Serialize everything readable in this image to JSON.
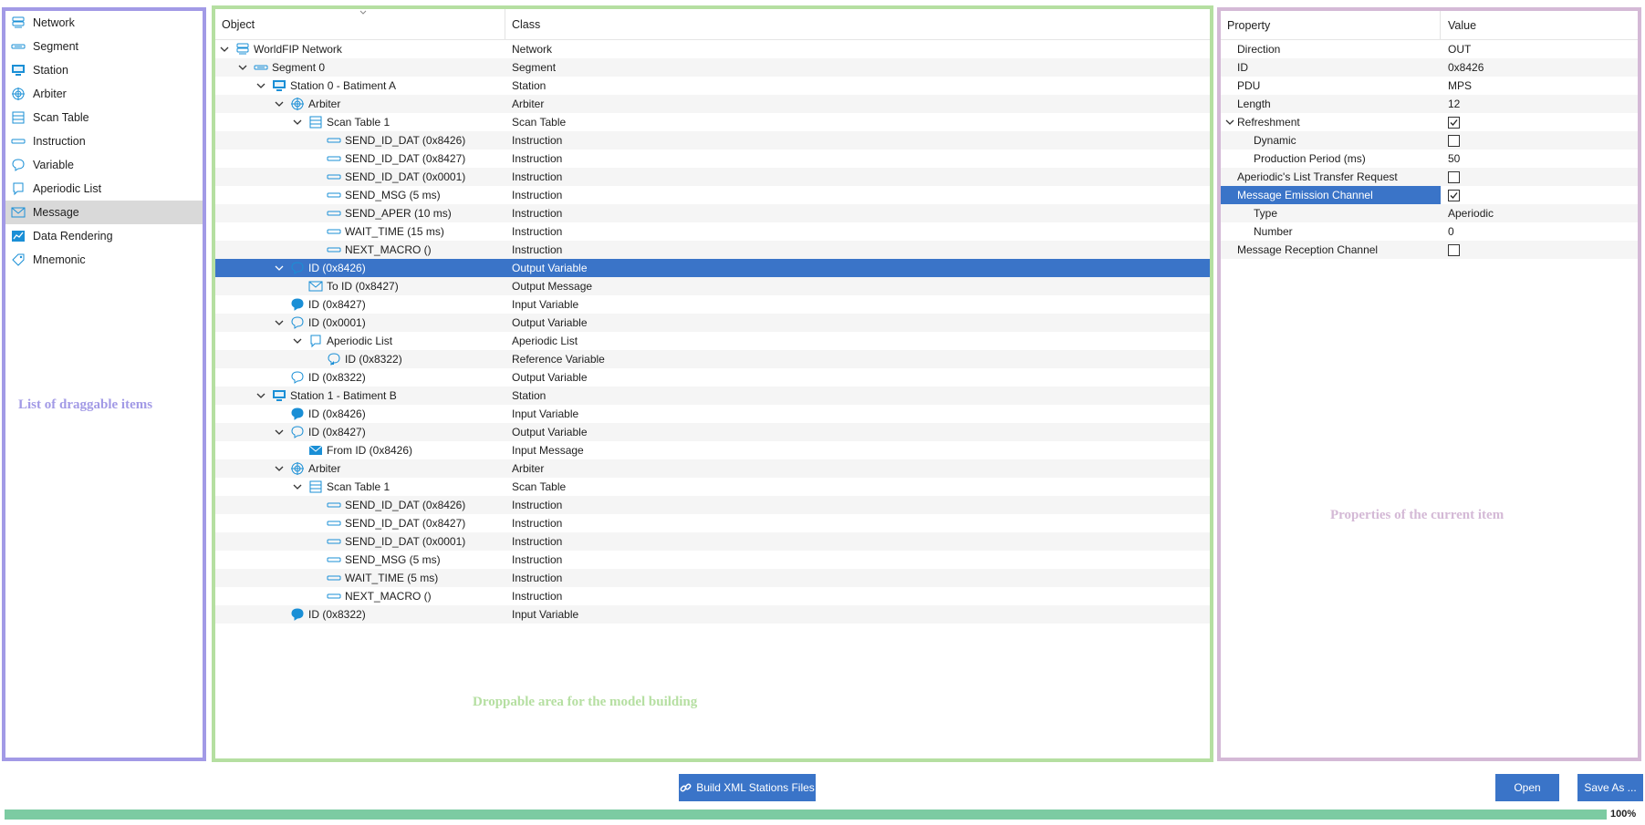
{
  "left_panel": {
    "overlay_label": "List of draggable items",
    "items": [
      {
        "label": "Network",
        "icon": "network-icon",
        "active": false
      },
      {
        "label": "Segment",
        "icon": "segment-icon",
        "active": false
      },
      {
        "label": "Station",
        "icon": "station-icon",
        "active": false
      },
      {
        "label": "Arbiter",
        "icon": "arbiter-icon",
        "active": false
      },
      {
        "label": "Scan Table",
        "icon": "scan-table-icon",
        "active": false
      },
      {
        "label": "Instruction",
        "icon": "instruction-icon",
        "active": false
      },
      {
        "label": "Variable",
        "icon": "variable-icon",
        "active": false
      },
      {
        "label": "Aperiodic List",
        "icon": "aperiodic-list-icon",
        "active": false
      },
      {
        "label": "Message",
        "icon": "message-icon",
        "active": true
      },
      {
        "label": "Data Rendering",
        "icon": "data-rendering-icon",
        "active": false
      },
      {
        "label": "Mnemonic",
        "icon": "mnemonic-icon",
        "active": false
      }
    ]
  },
  "tree": {
    "header": {
      "object": "Object",
      "class": "Class"
    },
    "overlay_label": "Droppable area for the model building",
    "rows": [
      {
        "depth": 0,
        "chevron": "down",
        "icon": "network-icon",
        "name": "WorldFIP Network",
        "class": "Network"
      },
      {
        "depth": 1,
        "chevron": "down",
        "icon": "segment-icon",
        "name": "Segment 0",
        "class": "Segment"
      },
      {
        "depth": 2,
        "chevron": "down",
        "icon": "station-icon",
        "name": "Station 0 - Batiment A",
        "class": "Station"
      },
      {
        "depth": 3,
        "chevron": "down",
        "icon": "arbiter-icon",
        "name": "Arbiter",
        "class": "Arbiter"
      },
      {
        "depth": 4,
        "chevron": "down",
        "icon": "scan-table-icon",
        "name": "Scan Table 1",
        "class": "Scan Table"
      },
      {
        "depth": 5,
        "chevron": "",
        "icon": "instruction-icon",
        "name": "SEND_ID_DAT (0x8426)",
        "class": "Instruction"
      },
      {
        "depth": 5,
        "chevron": "",
        "icon": "instruction-icon",
        "name": "SEND_ID_DAT (0x8427)",
        "class": "Instruction"
      },
      {
        "depth": 5,
        "chevron": "",
        "icon": "instruction-icon",
        "name": "SEND_ID_DAT (0x0001)",
        "class": "Instruction"
      },
      {
        "depth": 5,
        "chevron": "",
        "icon": "instruction-icon",
        "name": "SEND_MSG (5 ms)",
        "class": "Instruction"
      },
      {
        "depth": 5,
        "chevron": "",
        "icon": "instruction-icon",
        "name": "SEND_APER (10 ms)",
        "class": "Instruction"
      },
      {
        "depth": 5,
        "chevron": "",
        "icon": "instruction-icon",
        "name": "WAIT_TIME (15 ms)",
        "class": "Instruction"
      },
      {
        "depth": 5,
        "chevron": "",
        "icon": "instruction-icon",
        "name": "NEXT_MACRO ()",
        "class": "Instruction"
      },
      {
        "depth": 3,
        "chevron": "down",
        "icon": "output-variable-icon",
        "name": "ID (0x8426)",
        "class": "Output Variable",
        "selected": true
      },
      {
        "depth": 4,
        "chevron": "",
        "icon": "output-message-icon",
        "name": "To ID (0x8427)",
        "class": "Output Message"
      },
      {
        "depth": 3,
        "chevron": "",
        "icon": "input-variable-icon",
        "name": "ID (0x8427)",
        "class": "Input Variable"
      },
      {
        "depth": 3,
        "chevron": "down",
        "icon": "output-variable-icon",
        "name": "ID (0x0001)",
        "class": "Output Variable"
      },
      {
        "depth": 4,
        "chevron": "down",
        "icon": "aperiodic-list-icon",
        "name": "Aperiodic List",
        "class": "Aperiodic List"
      },
      {
        "depth": 5,
        "chevron": "",
        "icon": "reference-variable-icon",
        "name": "ID (0x8322)",
        "class": "Reference Variable"
      },
      {
        "depth": 3,
        "chevron": "",
        "icon": "output-variable-icon",
        "name": "ID (0x8322)",
        "class": "Output Variable"
      },
      {
        "depth": 2,
        "chevron": "down",
        "icon": "station-icon",
        "name": "Station 1 - Batiment B",
        "class": "Station"
      },
      {
        "depth": 3,
        "chevron": "",
        "icon": "input-variable-icon",
        "name": "ID (0x8426)",
        "class": "Input Variable"
      },
      {
        "depth": 3,
        "chevron": "down",
        "icon": "output-variable-icon",
        "name": "ID (0x8427)",
        "class": "Output Variable"
      },
      {
        "depth": 4,
        "chevron": "",
        "icon": "input-message-icon",
        "name": "From ID (0x8426)",
        "class": "Input Message"
      },
      {
        "depth": 3,
        "chevron": "down",
        "icon": "arbiter-icon",
        "name": "Arbiter",
        "class": "Arbiter"
      },
      {
        "depth": 4,
        "chevron": "down",
        "icon": "scan-table-icon",
        "name": "Scan Table 1",
        "class": "Scan Table"
      },
      {
        "depth": 5,
        "chevron": "",
        "icon": "instruction-icon",
        "name": "SEND_ID_DAT (0x8426)",
        "class": "Instruction"
      },
      {
        "depth": 5,
        "chevron": "",
        "icon": "instruction-icon",
        "name": "SEND_ID_DAT (0x8427)",
        "class": "Instruction"
      },
      {
        "depth": 5,
        "chevron": "",
        "icon": "instruction-icon",
        "name": "SEND_ID_DAT (0x0001)",
        "class": "Instruction"
      },
      {
        "depth": 5,
        "chevron": "",
        "icon": "instruction-icon",
        "name": "SEND_MSG (5 ms)",
        "class": "Instruction"
      },
      {
        "depth": 5,
        "chevron": "",
        "icon": "instruction-icon",
        "name": "WAIT_TIME (5 ms)",
        "class": "Instruction"
      },
      {
        "depth": 5,
        "chevron": "",
        "icon": "instruction-icon",
        "name": "NEXT_MACRO ()",
        "class": "Instruction"
      },
      {
        "depth": 3,
        "chevron": "",
        "icon": "input-variable-icon",
        "name": "ID (0x8322)",
        "class": "Input Variable"
      }
    ]
  },
  "properties": {
    "header": {
      "property": "Property",
      "value": "Value"
    },
    "overlay_label": "Properties of the current item",
    "rows": [
      {
        "depth": 0,
        "chevron": "",
        "name": "Direction",
        "value": "OUT"
      },
      {
        "depth": 0,
        "chevron": "",
        "name": "ID",
        "value": "0x8426"
      },
      {
        "depth": 0,
        "chevron": "",
        "name": "PDU",
        "value": "MPS"
      },
      {
        "depth": 0,
        "chevron": "",
        "name": "Length",
        "value": "12"
      },
      {
        "depth": 0,
        "chevron": "down",
        "name": "Refreshment",
        "checkbox": true,
        "checked": true
      },
      {
        "depth": 1,
        "chevron": "",
        "name": "Dynamic",
        "checkbox": true,
        "checked": false
      },
      {
        "depth": 1,
        "chevron": "",
        "name": "Production Period (ms)",
        "value": "50"
      },
      {
        "depth": 0,
        "chevron": "",
        "name": "Aperiodic's List Transfer Request",
        "checkbox": true,
        "checked": false
      },
      {
        "depth": 0,
        "chevron": "",
        "name": "Message Emission Channel",
        "checkbox": true,
        "checked": true,
        "selected": true
      },
      {
        "depth": 1,
        "chevron": "",
        "name": "Type",
        "value": "Aperiodic"
      },
      {
        "depth": 1,
        "chevron": "",
        "name": "Number",
        "value": "0"
      },
      {
        "depth": 0,
        "chevron": "",
        "name": "Message Reception Channel",
        "checkbox": true,
        "checked": false
      }
    ]
  },
  "bottom": {
    "build_button": "Build XML Stations Files",
    "open_button": "Open",
    "save_as_button": "Save As ...",
    "progress_percent": 100,
    "progress_label": "100%"
  },
  "colors": {
    "accent": "#3a74c8",
    "icon_blue": "#1a8fd6",
    "left_border": "#a29ae6",
    "center_border": "#b5dfa1",
    "right_border": "#d4b9d6",
    "progress": "#7ccba2"
  }
}
